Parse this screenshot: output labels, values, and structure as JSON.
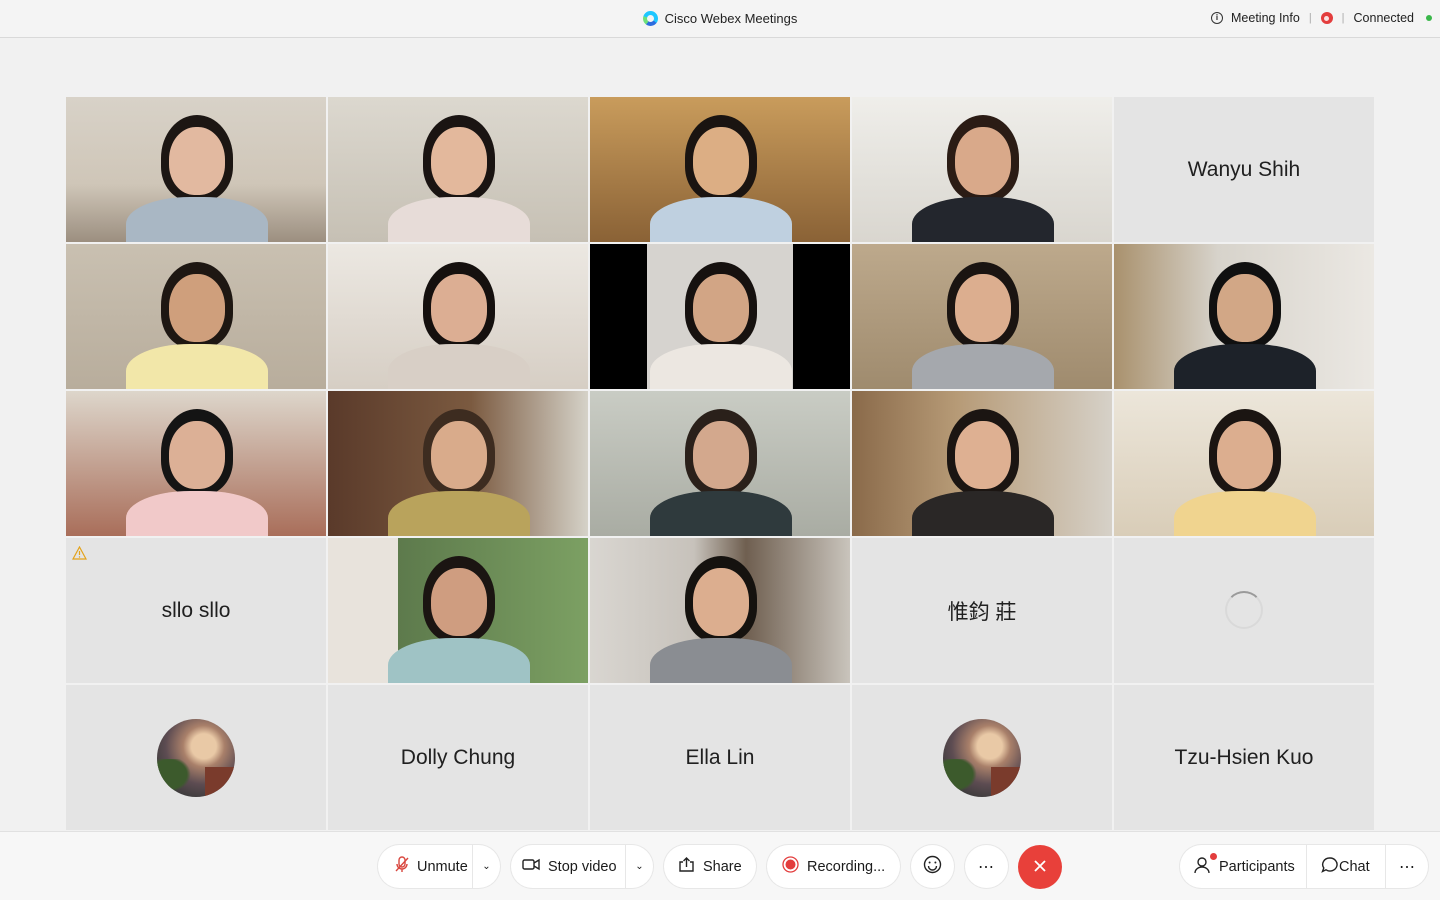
{
  "titlebar": {
    "app_title": "Cisco Webex Meetings",
    "meeting_info_label": "Meeting Info",
    "connection_status": "Connected"
  },
  "grid": {
    "tiles": [
      {
        "type": "video"
      },
      {
        "type": "video"
      },
      {
        "type": "video"
      },
      {
        "type": "video"
      },
      {
        "type": "name",
        "name": "Wanyu Shih"
      },
      {
        "type": "video"
      },
      {
        "type": "video"
      },
      {
        "type": "video"
      },
      {
        "type": "video"
      },
      {
        "type": "video"
      },
      {
        "type": "video"
      },
      {
        "type": "video"
      },
      {
        "type": "video"
      },
      {
        "type": "video"
      },
      {
        "type": "video"
      },
      {
        "type": "name",
        "name": "sllo sllo",
        "warning": true
      },
      {
        "type": "video"
      },
      {
        "type": "video"
      },
      {
        "type": "name",
        "name": "惟鈞 莊"
      },
      {
        "type": "loading"
      },
      {
        "type": "avatar"
      },
      {
        "type": "name",
        "name": "Dolly Chung"
      },
      {
        "type": "name",
        "name": "Ella Lin"
      },
      {
        "type": "avatar"
      },
      {
        "type": "name",
        "name": "Tzu-Hsien Kuo"
      }
    ]
  },
  "controls": {
    "unmute_label": "Unmute",
    "stop_video_label": "Stop video",
    "share_label": "Share",
    "recording_label": "Recording...",
    "participants_label": "Participants",
    "chat_label": "Chat"
  },
  "icons": {
    "mic": "mic-muted-icon",
    "video": "camera-icon",
    "share": "share-icon",
    "record": "record-icon",
    "reactions": "smiley-icon",
    "more": "ellipsis-icon",
    "end": "close-icon",
    "participants": "person-icon",
    "chat": "chat-bubble-icon"
  },
  "colors": {
    "end_call": "#e8403a",
    "recording": "#e33d3d",
    "connected": "#3ab74a"
  }
}
